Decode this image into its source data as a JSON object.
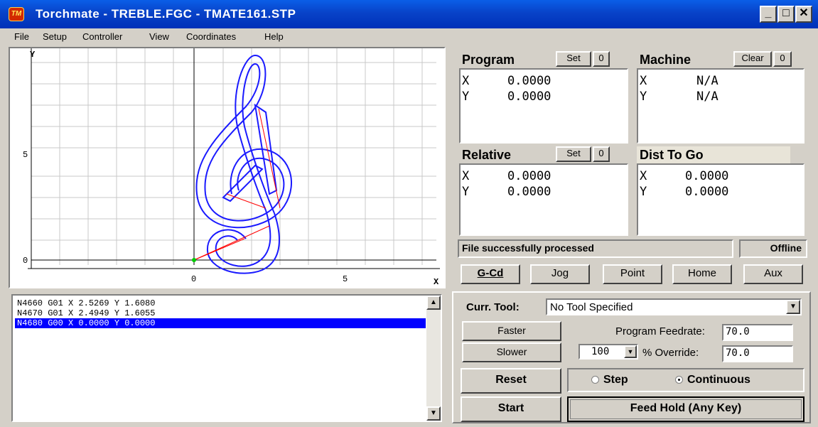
{
  "window": {
    "title": "Torchmate - TREBLE.FGC - TMATE161.STP",
    "icon": "app-logo-icon",
    "controls": [
      "_",
      "□",
      "✕"
    ]
  },
  "menu": [
    "File",
    "Setup",
    "Controller",
    "View",
    "Coordinates",
    "Help"
  ],
  "plot": {
    "axis_x_label": "X",
    "axis_y_label": "Y",
    "x_ticks": [
      "0",
      "5"
    ],
    "y_ticks": [
      "0",
      "5"
    ]
  },
  "gcode": {
    "lines": [
      "N4660 G01 X 2.5269 Y 1.6080",
      "N4670 G01 X 2.4949 Y 1.6055",
      "N4680 G00 X 0.0000 Y 0.0000"
    ],
    "selected_index": 2
  },
  "dro": {
    "program": {
      "title": "Program",
      "set": "Set",
      "zero": "0",
      "x_label": "X",
      "x": "0.0000",
      "y_label": "Y",
      "y": "0.0000"
    },
    "machine": {
      "title": "Machine",
      "clear": "Clear",
      "zero": "0",
      "x_label": "X",
      "x": "N/A",
      "y_label": "Y",
      "y": "N/A"
    },
    "relative": {
      "title": "Relative",
      "set": "Set",
      "zero": "0",
      "x_label": "X",
      "x": "0.0000",
      "y_label": "Y",
      "y": "0.0000"
    },
    "dist_to_go": {
      "title": "Dist To Go",
      "x_label": "X",
      "x": "0.0000",
      "y_label": "Y",
      "y": "0.0000"
    }
  },
  "status": {
    "message": "File successfully processed",
    "connection": "Offline"
  },
  "tabs": [
    "G-Cd",
    "Jog",
    "Point",
    "Home",
    "Aux"
  ],
  "controls": {
    "tool_label": "Curr. Tool:",
    "tool_value": "No Tool Specified",
    "faster": "Faster",
    "slower": "Slower",
    "feedrate_label": "Program Feedrate:",
    "feedrate_value": "70.0",
    "override_select": "100",
    "override_label": "% Override:",
    "override_value": "70.0",
    "reset": "Reset",
    "step": "Step",
    "continuous": "Continuous",
    "mode_selected": "continuous",
    "start": "Start",
    "feed_hold": "Feed Hold (Any Key)"
  },
  "colors": {
    "titlebar": "#0842c8",
    "selection": "#0000ff",
    "toolpath": "#1a1aff",
    "rapid": "#ff0000"
  }
}
